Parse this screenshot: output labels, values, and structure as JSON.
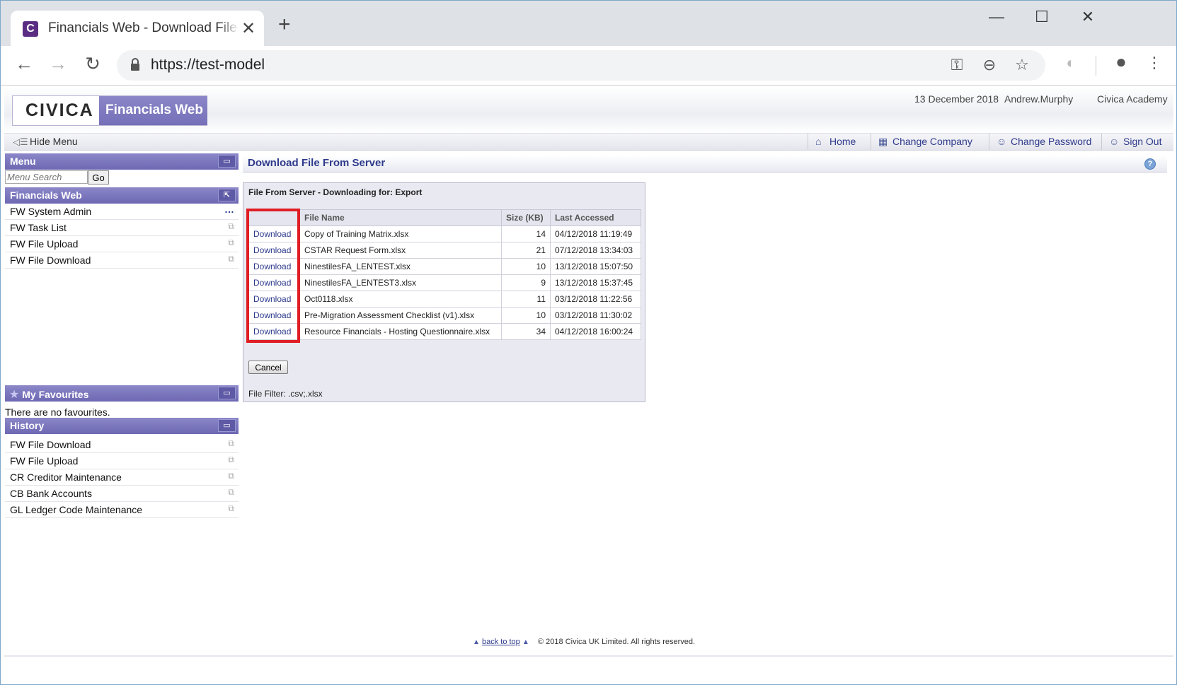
{
  "browser": {
    "tab_title": "Financials Web - Download File From Server",
    "tab_favicon_letter": "C",
    "url": "https://test-model",
    "controls": {
      "close_tab": "✕",
      "new_tab": "+",
      "minimize": "—",
      "maximize": "☐",
      "close_window": "✕",
      "back": "←",
      "forward": "→",
      "reload": "↻",
      "key": "⚿",
      "zoom": "⊖",
      "star": "☆",
      "extension": "◐",
      "account": "●",
      "more": "⋮"
    }
  },
  "header": {
    "logo_text": "CIVICA",
    "product_name": "Financials Web",
    "date": "13 December 2018",
    "user": "Andrew.Murphy",
    "company": "Civica Academy"
  },
  "menubar": {
    "hide_menu": "Hide Menu",
    "nav": [
      {
        "label": "Home",
        "icon": "home-icon",
        "glyph": "⌂"
      },
      {
        "label": "Change Company",
        "icon": "building-icon",
        "glyph": "▦"
      },
      {
        "label": "Change Password",
        "icon": "user-key-icon",
        "glyph": "☺"
      },
      {
        "label": "Sign Out",
        "icon": "sign-out-icon",
        "glyph": "☺"
      }
    ]
  },
  "sidebar": {
    "menu_title": "Menu",
    "search_placeholder": "Menu Search",
    "search_go": "Go",
    "financials_title": "Financials Web",
    "financials_items": [
      "FW System Admin",
      "FW Task List",
      "FW File Upload",
      "FW File Download"
    ],
    "favourites_title": "My Favourites",
    "favourites_empty": "There are no favourites.",
    "history_title": "History",
    "history_items": [
      "FW File Download",
      "FW File Upload",
      "CR Creditor Maintenance",
      "CB Bank Accounts",
      "GL Ledger Code Maintenance"
    ]
  },
  "main": {
    "page_title": "Download File From Server",
    "panel_heading": "File From Server - Downloading for: Export",
    "columns": [
      "",
      "File Name",
      "Size (KB)",
      "Last Accessed"
    ],
    "download_label": "Download",
    "files": [
      {
        "name": "Copy of Training Matrix.xlsx",
        "size": "14",
        "accessed": "04/12/2018 11:19:49"
      },
      {
        "name": "CSTAR Request Form.xlsx",
        "size": "21",
        "accessed": "07/12/2018 13:34:03"
      },
      {
        "name": "NinestilesFA_LENTEST.xlsx",
        "size": "10",
        "accessed": "13/12/2018 15:07:50"
      },
      {
        "name": "NinestilesFA_LENTEST3.xlsx",
        "size": "9",
        "accessed": "13/12/2018 15:37:45"
      },
      {
        "name": "Oct0118.xlsx",
        "size": "11",
        "accessed": "03/12/2018 11:22:56"
      },
      {
        "name": "Pre-Migration Assessment Checklist (v1).xlsx",
        "size": "10",
        "accessed": "03/12/2018 11:30:02"
      },
      {
        "name": "Resource Financials - Hosting Questionnaire.xlsx",
        "size": "34",
        "accessed": "04/12/2018 16:00:24"
      }
    ],
    "cancel_label": "Cancel",
    "file_filter": "File Filter: .csv;.xlsx"
  },
  "footer": {
    "back_to_top": "back to top",
    "copyright": "© 2018 Civica UK Limited. All rights reserved."
  },
  "colors": {
    "accent": "#7570b8",
    "link": "#2e3a8c",
    "highlight": "#e01d24"
  }
}
